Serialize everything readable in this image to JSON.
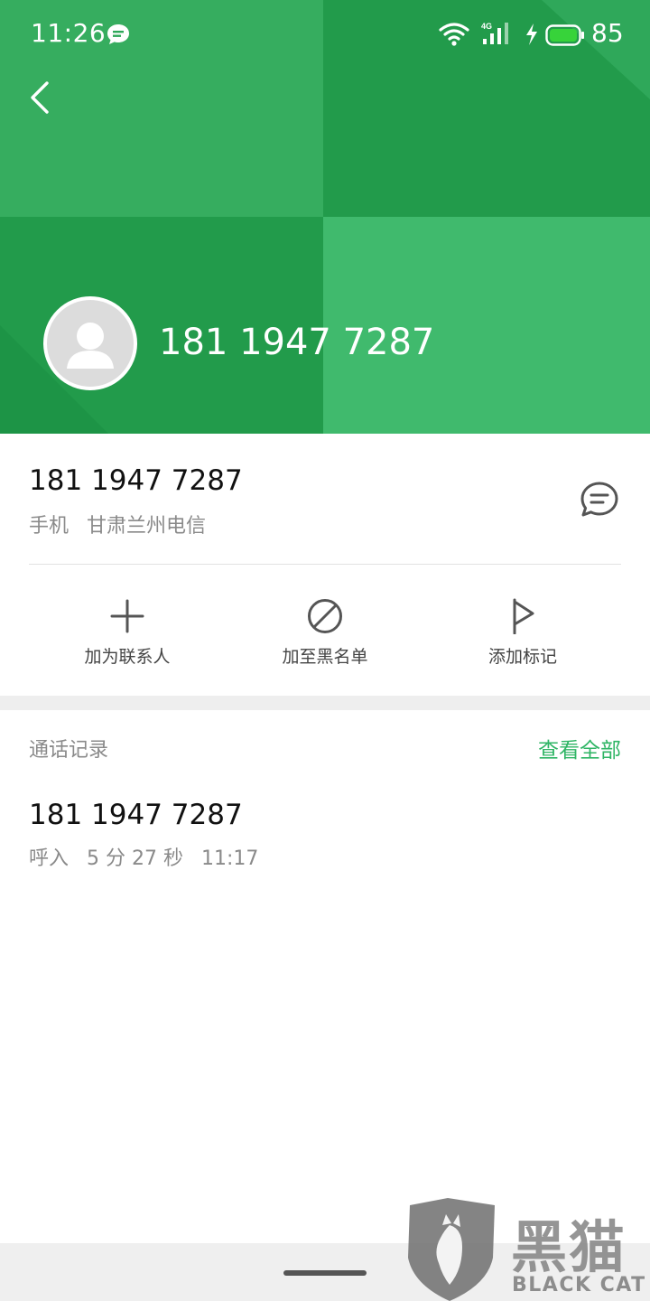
{
  "status_bar": {
    "time": "11:26",
    "network": "4G",
    "battery_level": "85"
  },
  "header": {
    "phone_number": "181 1947 7287",
    "accent_color": "#3ab566"
  },
  "info": {
    "phone_number": "181 1947 7287",
    "type_label": "手机",
    "location": "甘肃兰州电信"
  },
  "actions": [
    {
      "label": "加为联系人",
      "icon": "plus-icon"
    },
    {
      "label": "加至黑名单",
      "icon": "block-icon"
    },
    {
      "label": "添加标记",
      "icon": "flag-icon"
    }
  ],
  "call_log": {
    "title": "通话记录",
    "view_all": "查看全部",
    "items": [
      {
        "number": "181 1947 7287",
        "direction": "呼入",
        "duration": "5 分 27 秒",
        "time": "11:17"
      }
    ]
  },
  "watermark": {
    "cn": "黑猫",
    "en": "BLACK CAT"
  }
}
